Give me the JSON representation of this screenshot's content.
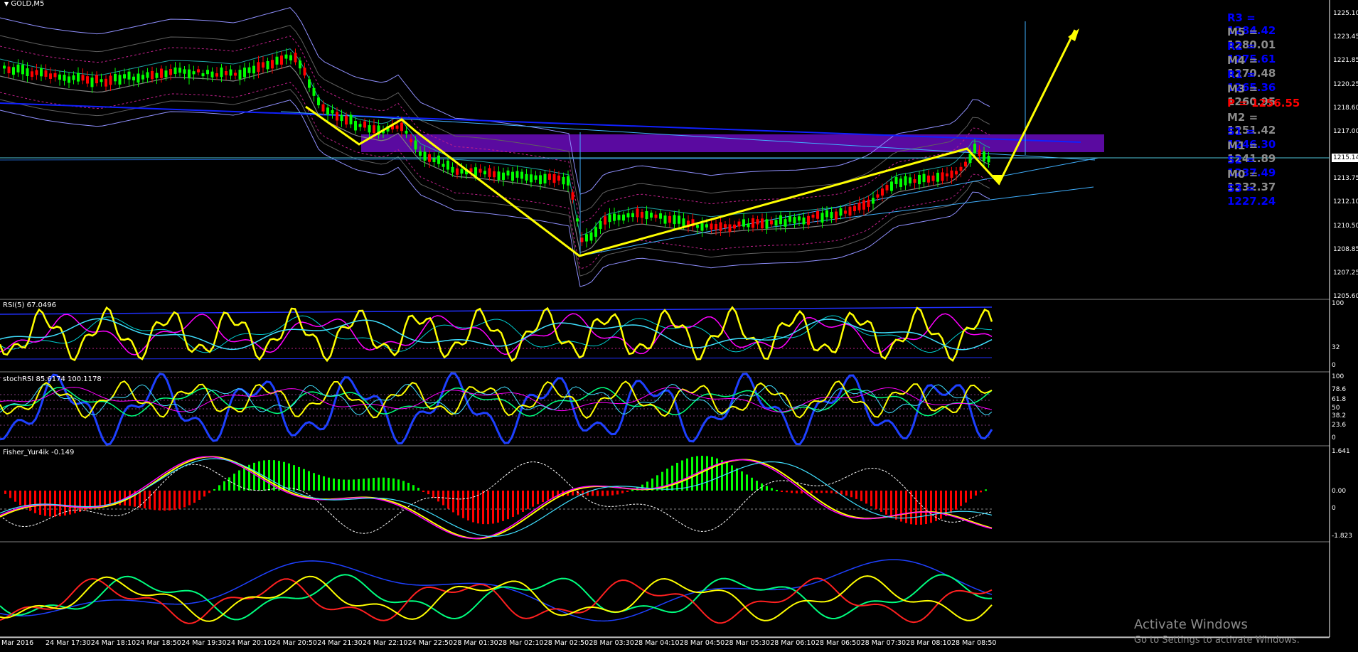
{
  "chart": {
    "title": "GOLD,M5",
    "current_price": "1215.14",
    "price_ticks": [
      "1225.10",
      "1223.45",
      "1221.85",
      "1220.25",
      "1218.60",
      "1217.00",
      "1213.75",
      "1212.10",
      "1210.50",
      "1208.85",
      "1207.25",
      "1205.60"
    ]
  },
  "pivots": [
    {
      "text": "R3 = 1284.42",
      "color": "#0000ff"
    },
    {
      "text": "M5 = 1280.01",
      "color": "#8c8c8c"
    },
    {
      "text": "R2 = 1275.61",
      "color": "#0000ff"
    },
    {
      "text": "M4 = 1270.48",
      "color": "#8c8c8c"
    },
    {
      "text": "R1 = 1265.36",
      "color": "#0000ff"
    },
    {
      "text": "M3 = 1260.95",
      "color": "#8c8c8c"
    },
    {
      "text": "P   = 1256.55",
      "color": "#ff0000"
    },
    {
      "text": "M2 = 1251.42",
      "color": "#8c8c8c"
    },
    {
      "text": "S1 = 1246.30",
      "color": "#0000ff"
    },
    {
      "text": "M1 = 1241.89",
      "color": "#8c8c8c"
    },
    {
      "text": "S2 = 1237.49",
      "color": "#0000ff"
    },
    {
      "text": "M0 = 1232.37",
      "color": "#8c8c8c"
    },
    {
      "text": "S3 = 1227.24",
      "color": "#0000ff"
    }
  ],
  "rsi": {
    "label": "RSI(5) 67.0496",
    "ticks": [
      "100",
      "32",
      "0"
    ]
  },
  "stochrsi": {
    "label": "stochRSI 85.6174 100.1178",
    "ticks": [
      "100",
      "78.6",
      "61.8",
      "50",
      "38.2",
      "23.6",
      "0"
    ]
  },
  "fisher": {
    "label": "Fisher_Yur4ik -0.149",
    "ticks": [
      "1.641",
      "0.00",
      "0",
      "-1.823"
    ]
  },
  "time_axis": [
    "Mar 2016",
    "24 Mar 17:30",
    "24 Mar 18:10",
    "24 Mar 18:50",
    "24 Mar 19:30",
    "24 Mar 20:10",
    "24 Mar 20:50",
    "24 Mar 21:30",
    "24 Mar 22:10",
    "24 Mar 22:50",
    "28 Mar 01:30",
    "28 Mar 02:10",
    "28 Mar 02:50",
    "28 Mar 03:30",
    "28 Mar 04:10",
    "28 Mar 04:50",
    "28 Mar 05:30",
    "28 Mar 06:10",
    "28 Mar 06:50",
    "28 Mar 07:30",
    "28 Mar 08:10",
    "28 Mar 08:50"
  ],
  "watermark": {
    "line1": "Activate Windows",
    "line2": "Go to Settings to activate Windows."
  },
  "colors": {
    "bull": "#00ff00",
    "bear": "#ff0000",
    "arrow": "#ffff00",
    "zone": "#5a0aa0",
    "axis": "#ffffff"
  }
}
